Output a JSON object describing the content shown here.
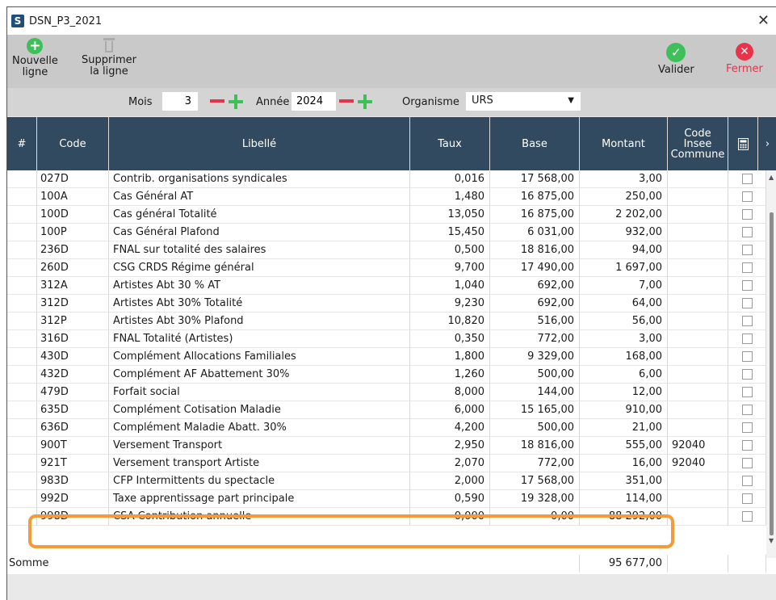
{
  "window": {
    "title": "DSN_P3_2021",
    "logo": "S"
  },
  "toolbar": {
    "new_line_1": "Nouvelle",
    "new_line_2": "ligne",
    "delete_1": "Supprimer",
    "delete_2": "la ligne",
    "validate": "Valider",
    "close": "Fermer"
  },
  "filters": {
    "mois_label": "Mois",
    "mois_value": "3",
    "annee_label": "Année",
    "annee_value": "2024",
    "organisme_label": "Organisme",
    "organisme_value": "URS"
  },
  "table": {
    "headers": {
      "num": "#",
      "code": "Code",
      "libelle": "Libellé",
      "taux": "Taux",
      "base": "Base",
      "montant": "Montant",
      "insee_1": "Code",
      "insee_2": "Insee",
      "insee_3": "Commune"
    },
    "rows": [
      {
        "code": "027D",
        "libelle": "Contrib. organisations syndicales",
        "taux": "0,016",
        "base": "17 568,00",
        "montant": "3,00",
        "insee": ""
      },
      {
        "code": "100A",
        "libelle": "Cas Général AT",
        "taux": "1,480",
        "base": "16 875,00",
        "montant": "250,00",
        "insee": ""
      },
      {
        "code": "100D",
        "libelle": "Cas général Totalité",
        "taux": "13,050",
        "base": "16 875,00",
        "montant": "2 202,00",
        "insee": ""
      },
      {
        "code": "100P",
        "libelle": "Cas Général Plafond",
        "taux": "15,450",
        "base": "6 031,00",
        "montant": "932,00",
        "insee": ""
      },
      {
        "code": "236D",
        "libelle": "FNAL sur totalité des salaires",
        "taux": "0,500",
        "base": "18 816,00",
        "montant": "94,00",
        "insee": ""
      },
      {
        "code": "260D",
        "libelle": "CSG CRDS Régime général",
        "taux": "9,700",
        "base": "17 490,00",
        "montant": "1 697,00",
        "insee": ""
      },
      {
        "code": "312A",
        "libelle": "Artistes Abt 30 % AT",
        "taux": "1,040",
        "base": "692,00",
        "montant": "7,00",
        "insee": ""
      },
      {
        "code": "312D",
        "libelle": "Artistes Abt 30% Totalité",
        "taux": "9,230",
        "base": "692,00",
        "montant": "64,00",
        "insee": ""
      },
      {
        "code": "312P",
        "libelle": "Artistes Abt 30% Plafond",
        "taux": "10,820",
        "base": "516,00",
        "montant": "56,00",
        "insee": ""
      },
      {
        "code": "316D",
        "libelle": "FNAL Totalité (Artistes)",
        "taux": "0,350",
        "base": "772,00",
        "montant": "3,00",
        "insee": ""
      },
      {
        "code": "430D",
        "libelle": "Complément Allocations Familiales",
        "taux": "1,800",
        "base": "9 329,00",
        "montant": "168,00",
        "insee": ""
      },
      {
        "code": "432D",
        "libelle": "Complément AF Abattement 30%",
        "taux": "1,260",
        "base": "500,00",
        "montant": "6,00",
        "insee": ""
      },
      {
        "code": "479D",
        "libelle": "Forfait social",
        "taux": "8,000",
        "base": "144,00",
        "montant": "12,00",
        "insee": ""
      },
      {
        "code": "635D",
        "libelle": "Complément Cotisation Maladie",
        "taux": "6,000",
        "base": "15 165,00",
        "montant": "910,00",
        "insee": ""
      },
      {
        "code": "636D",
        "libelle": "Complément Maladie Abatt. 30%",
        "taux": "4,200",
        "base": "500,00",
        "montant": "21,00",
        "insee": ""
      },
      {
        "code": "900T",
        "libelle": "Versement Transport",
        "taux": "2,950",
        "base": "18 816,00",
        "montant": "555,00",
        "insee": "92040"
      },
      {
        "code": "921T",
        "libelle": "Versement transport Artiste",
        "taux": "2,070",
        "base": "772,00",
        "montant": "16,00",
        "insee": "92040"
      },
      {
        "code": "983D",
        "libelle": "CFP Intermittents du spectacle",
        "taux": "2,000",
        "base": "17 568,00",
        "montant": "351,00",
        "insee": ""
      },
      {
        "code": "992D",
        "libelle": "Taxe apprentissage part principale",
        "taux": "0,590",
        "base": "19 328,00",
        "montant": "114,00",
        "insee": ""
      },
      {
        "code": "998D",
        "libelle": "CSA Contribution annuelle",
        "taux": "0,000",
        "base": "0,00",
        "montant": "88 292,00",
        "insee": ""
      }
    ],
    "sum_label": "Somme",
    "sum_value": "95 677,00"
  },
  "colors": {
    "header_bg": "#324a5f",
    "highlight": "#f29b38",
    "green": "#3fbf5a",
    "red": "#e8334a"
  }
}
